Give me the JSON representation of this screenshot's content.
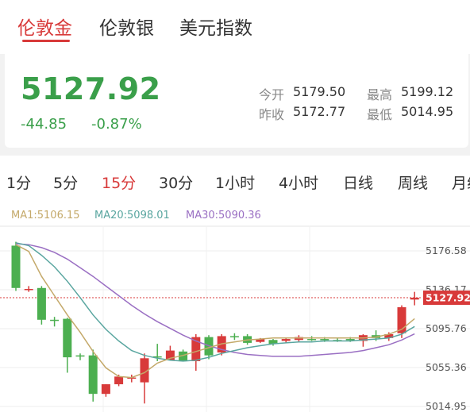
{
  "tabs": [
    {
      "label": "伦敦金"
    },
    {
      "label": "伦敦银"
    },
    {
      "label": "美元指数"
    }
  ],
  "quote": {
    "price": "5127.92",
    "change": "-44.85",
    "change_pct": "-0.87%",
    "stats": [
      {
        "label": "今开",
        "value": "5179.50"
      },
      {
        "label": "最高",
        "value": "5199.12"
      },
      {
        "label": "昨收",
        "value": "5172.77"
      },
      {
        "label": "最低",
        "value": "5014.95"
      }
    ]
  },
  "periods": [
    {
      "label": "1分"
    },
    {
      "label": "5分"
    },
    {
      "label": "15分"
    },
    {
      "label": "30分"
    },
    {
      "label": "1小时"
    },
    {
      "label": "4小时"
    },
    {
      "label": "日线"
    },
    {
      "label": "周线"
    },
    {
      "label": "月线"
    }
  ],
  "active_period": "15分",
  "colors": {
    "up": "#d83a3a",
    "down": "#4caf50",
    "ma1": "#c4a96a",
    "ma20": "#5aa6a0",
    "ma30": "#9a6fc3"
  },
  "ma_legend": {
    "ma1": "MA1:5106.15",
    "ma20": "MA20:5098.01",
    "ma30": "MA30:5090.36"
  },
  "chart_data": {
    "type": "candlestick",
    "y_ticks": [
      "5176.58",
      "5136.17",
      "5095.76",
      "5055.36",
      "5014.95"
    ],
    "ylim": [
      5014.95,
      5190
    ],
    "current_price": "5127.92",
    "candles": [
      {
        "o": 5182,
        "h": 5186,
        "l": 5135,
        "c": 5138
      },
      {
        "o": 5137,
        "h": 5140,
        "l": 5134,
        "c": 5137
      },
      {
        "o": 5138,
        "h": 5140,
        "l": 5100,
        "c": 5105
      },
      {
        "o": 5105,
        "h": 5108,
        "l": 5098,
        "c": 5104
      },
      {
        "o": 5106,
        "h": 5107,
        "l": 5050,
        "c": 5066
      },
      {
        "o": 5068,
        "h": 5070,
        "l": 5063,
        "c": 5067
      },
      {
        "o": 5068,
        "h": 5074,
        "l": 5020,
        "c": 5028
      },
      {
        "o": 5028,
        "h": 5038,
        "l": 5025,
        "c": 5038
      },
      {
        "o": 5038,
        "h": 5048,
        "l": 5036,
        "c": 5046
      },
      {
        "o": 5045,
        "h": 5048,
        "l": 5040,
        "c": 5045
      },
      {
        "o": 5040,
        "h": 5070,
        "l": 5018,
        "c": 5065
      },
      {
        "o": 5067,
        "h": 5080,
        "l": 5062,
        "c": 5066
      },
      {
        "o": 5063,
        "h": 5078,
        "l": 5063,
        "c": 5073
      },
      {
        "o": 5072,
        "h": 5074,
        "l": 5062,
        "c": 5062
      },
      {
        "o": 5062,
        "h": 5090,
        "l": 5052,
        "c": 5087
      },
      {
        "o": 5087,
        "h": 5089,
        "l": 5064,
        "c": 5068
      },
      {
        "o": 5071,
        "h": 5090,
        "l": 5068,
        "c": 5088
      },
      {
        "o": 5088,
        "h": 5091,
        "l": 5084,
        "c": 5087
      },
      {
        "o": 5088,
        "h": 5090,
        "l": 5079,
        "c": 5081
      },
      {
        "o": 5082,
        "h": 5086,
        "l": 5081,
        "c": 5085
      },
      {
        "o": 5084,
        "h": 5085,
        "l": 5078,
        "c": 5080
      },
      {
        "o": 5083,
        "h": 5086,
        "l": 5081,
        "c": 5085
      },
      {
        "o": 5084,
        "h": 5089,
        "l": 5082,
        "c": 5087
      },
      {
        "o": 5085,
        "h": 5088,
        "l": 5083,
        "c": 5084
      },
      {
        "o": 5085,
        "h": 5087,
        "l": 5082,
        "c": 5084
      },
      {
        "o": 5084,
        "h": 5086,
        "l": 5082,
        "c": 5083
      },
      {
        "o": 5085,
        "h": 5087,
        "l": 5082,
        "c": 5084
      },
      {
        "o": 5083,
        "h": 5090,
        "l": 5077,
        "c": 5089
      },
      {
        "o": 5089,
        "h": 5094,
        "l": 5083,
        "c": 5086
      },
      {
        "o": 5086,
        "h": 5092,
        "l": 5083,
        "c": 5090
      },
      {
        "o": 5091,
        "h": 5120,
        "l": 5086,
        "c": 5118
      },
      {
        "o": 5126,
        "h": 5134,
        "l": 5120,
        "c": 5127.92
      }
    ],
    "ma1": [
      5183,
      5176,
      5150,
      5130,
      5110,
      5092,
      5072,
      5055,
      5046,
      5045,
      5050,
      5060,
      5065,
      5068,
      5072,
      5076,
      5080,
      5082,
      5084,
      5085,
      5086,
      5086,
      5086,
      5086,
      5086,
      5086,
      5086,
      5086,
      5087,
      5090,
      5095,
      5106.15
    ],
    "ma20": [
      5185,
      5182,
      5172,
      5160,
      5145,
      5128,
      5110,
      5095,
      5083,
      5073,
      5068,
      5065,
      5063,
      5062,
      5063,
      5066,
      5070,
      5073,
      5076,
      5078,
      5080,
      5081,
      5082,
      5082,
      5083,
      5083,
      5083,
      5084,
      5085,
      5086,
      5090,
      5098.01
    ],
    "ma30": [
      5184,
      5183,
      5180,
      5175,
      5168,
      5159,
      5150,
      5140,
      5130,
      5120,
      5111,
      5103,
      5096,
      5089,
      5083,
      5078,
      5074,
      5071,
      5069,
      5068,
      5067,
      5067,
      5067,
      5068,
      5069,
      5070,
      5071,
      5073,
      5076,
      5079,
      5084,
      5090.36
    ]
  }
}
